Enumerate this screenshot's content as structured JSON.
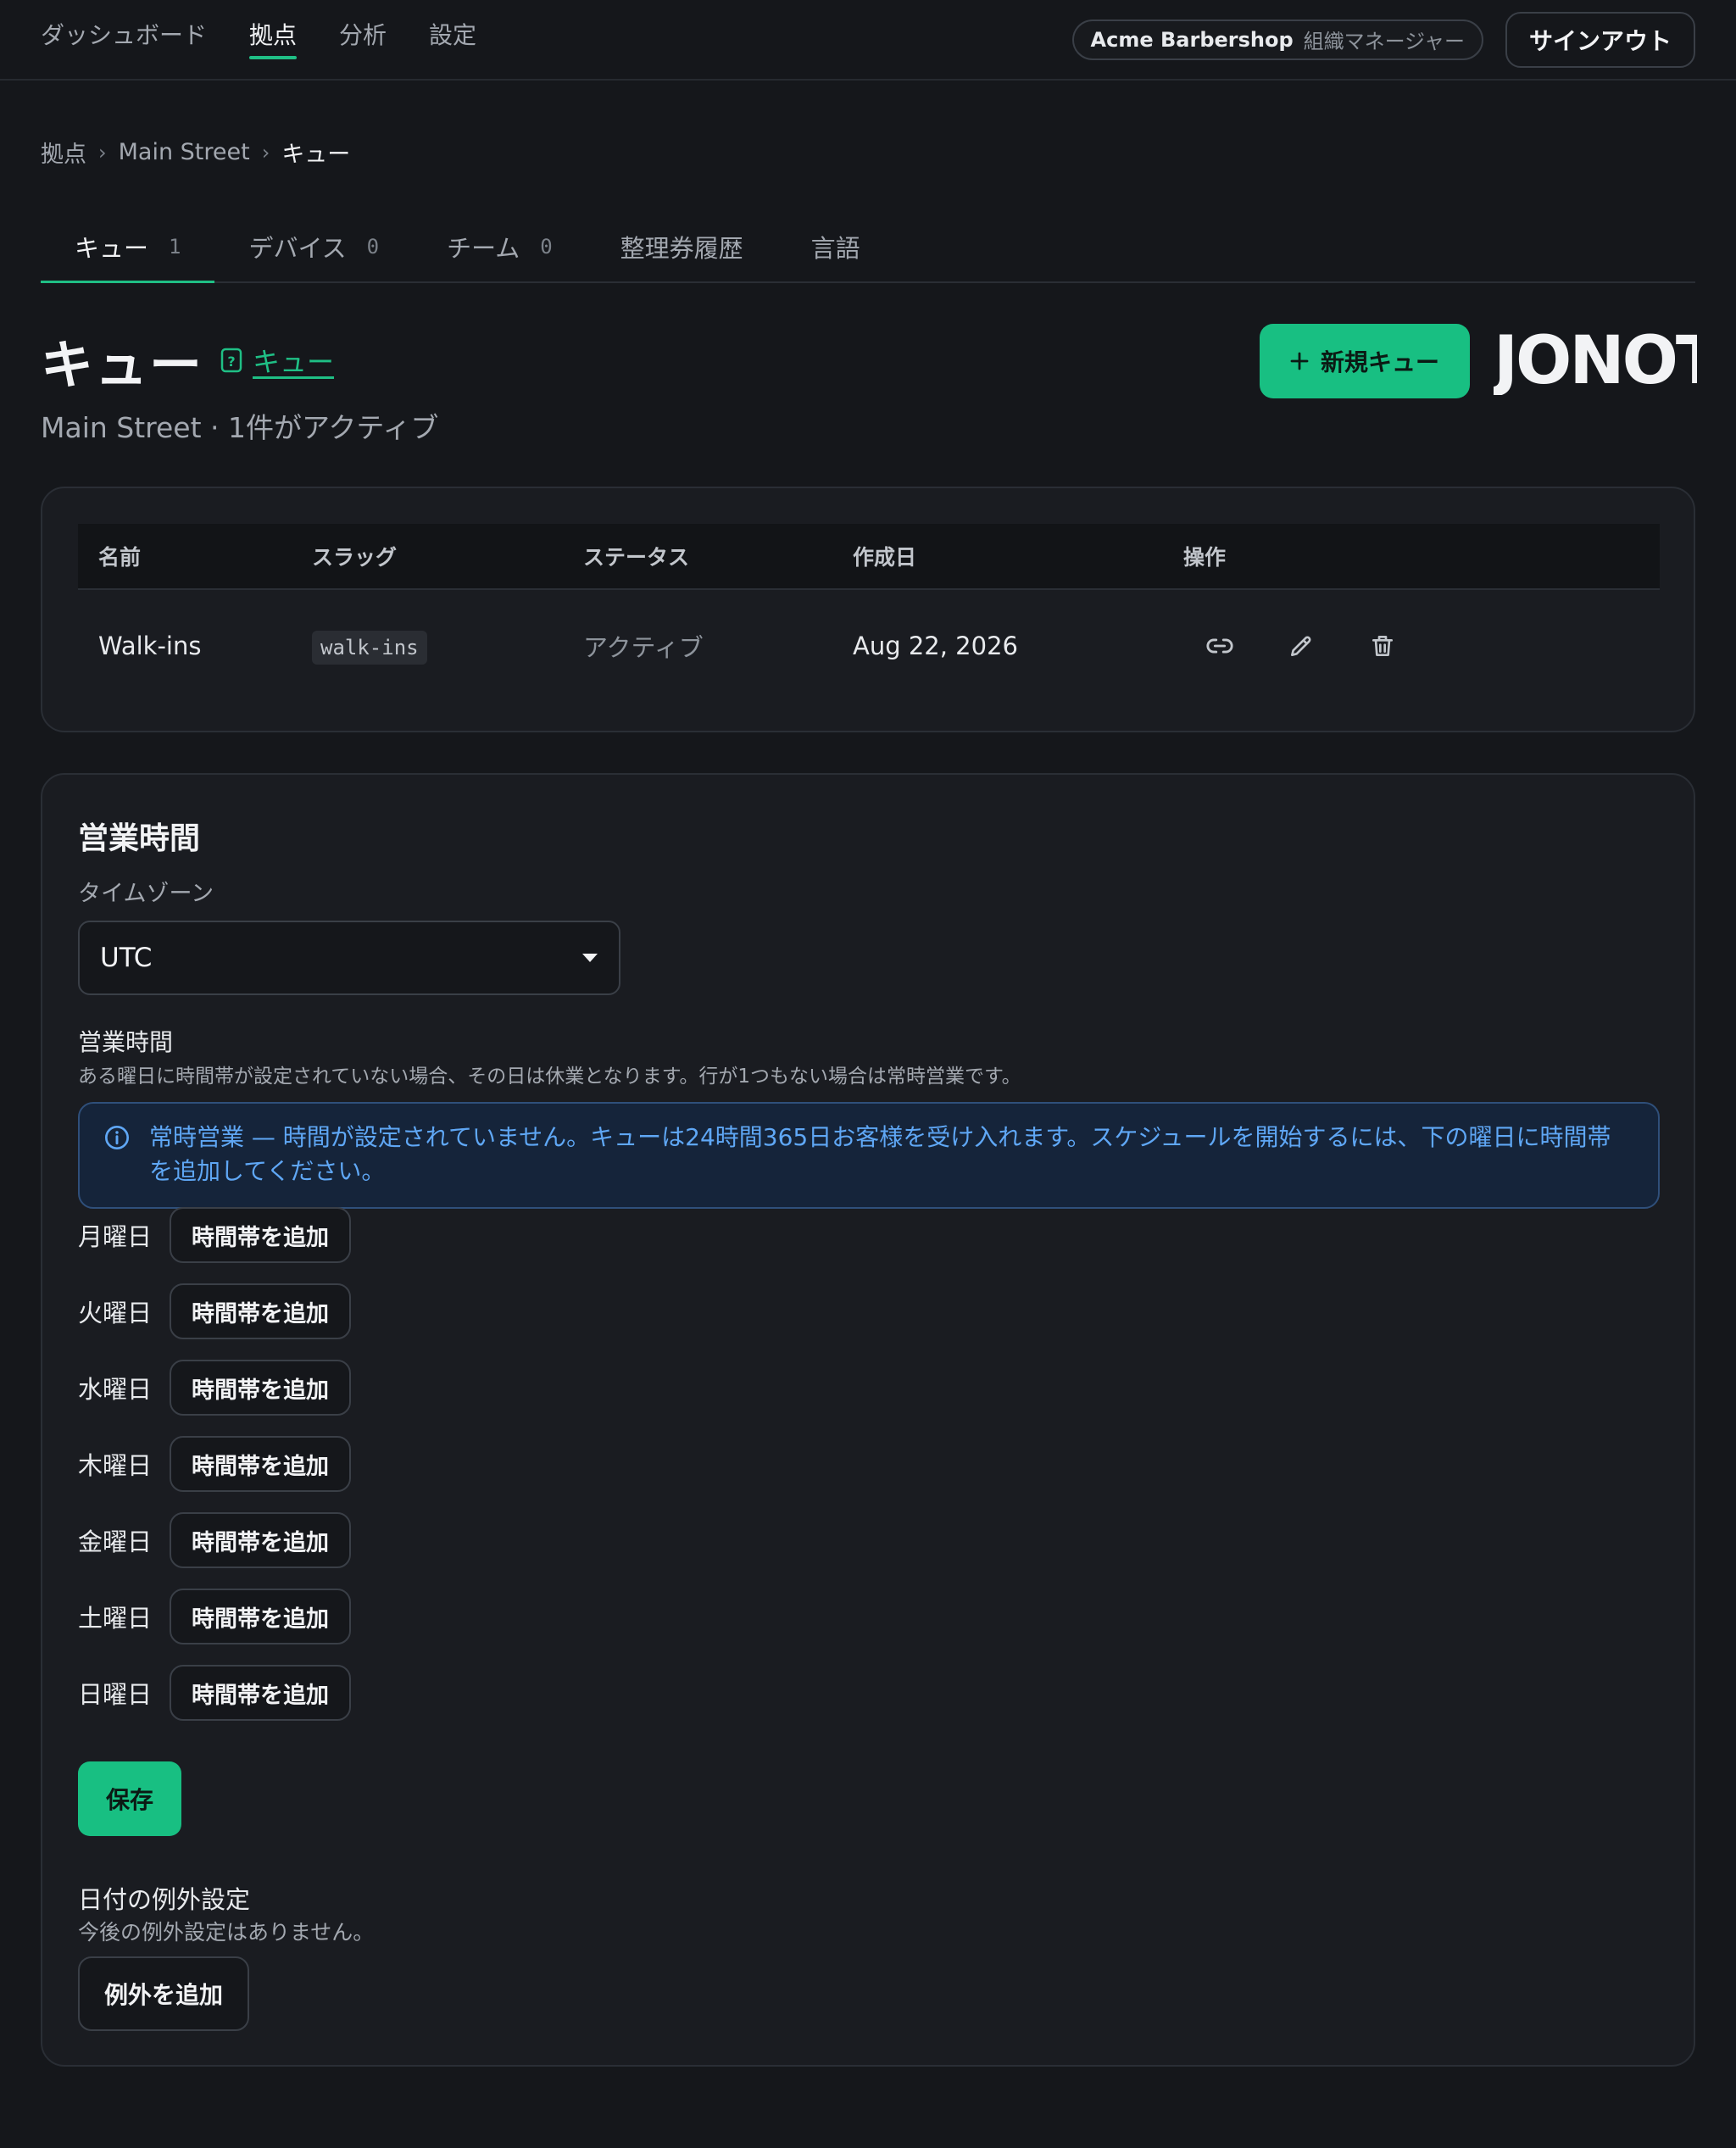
{
  "topnav": {
    "items": [
      {
        "label": "ダッシュボード",
        "active": false
      },
      {
        "label": "拠点",
        "active": true
      },
      {
        "label": "分析",
        "active": false
      },
      {
        "label": "設定",
        "active": false
      }
    ],
    "org_name": "Acme Barbershop",
    "org_role": "組織マネージャー",
    "signout_label": "サインアウト"
  },
  "breadcrumb": {
    "root": "拠点",
    "location": "Main Street",
    "current": "キュー"
  },
  "tabs": [
    {
      "label": "キュー",
      "count": "1",
      "active": true
    },
    {
      "label": "デバイス",
      "count": "0",
      "active": false
    },
    {
      "label": "チーム",
      "count": "0",
      "active": false
    },
    {
      "label": "整理券履歴",
      "count": "",
      "active": false
    },
    {
      "label": "言語",
      "count": "",
      "active": false
    }
  ],
  "header": {
    "title": "キュー",
    "help_link": "キュー",
    "subtitle": "Main Street · 1件がアクティブ",
    "new_button": "新規キュー",
    "logo_text": "JONOT"
  },
  "table": {
    "columns": [
      "名前",
      "スラッグ",
      "ステータス",
      "作成日",
      "操作"
    ],
    "rows": [
      {
        "name": "Walk-ins",
        "slug": "walk-ins",
        "status": "アクティブ",
        "created": "Aug 22, 2026"
      }
    ]
  },
  "hours": {
    "title": "営業時間",
    "timezone_label": "タイムゾーン",
    "timezone_value": "UTC",
    "section_label": "営業時間",
    "help_text": "ある曜日に時間帯が設定されていない場合、その日は休業となります。行が1つもない場合は常時営業です。",
    "alert_text": "常時営業 — 時間が設定されていません。キューは24時間365日お客様を受け入れます。スケジュールを開始するには、下の曜日に時間帯を追加してください。",
    "add_slot_label": "時間帯を追加",
    "days": [
      "月曜日",
      "火曜日",
      "水曜日",
      "木曜日",
      "金曜日",
      "土曜日",
      "日曜日"
    ],
    "save_label": "保存"
  },
  "exceptions": {
    "title": "日付の例外設定",
    "help_text": "今後の例外設定はありません。",
    "add_label": "例外を追加"
  },
  "colors": {
    "accent": "#18bf82",
    "background": "#15171b",
    "info": "#5fa7f5"
  }
}
